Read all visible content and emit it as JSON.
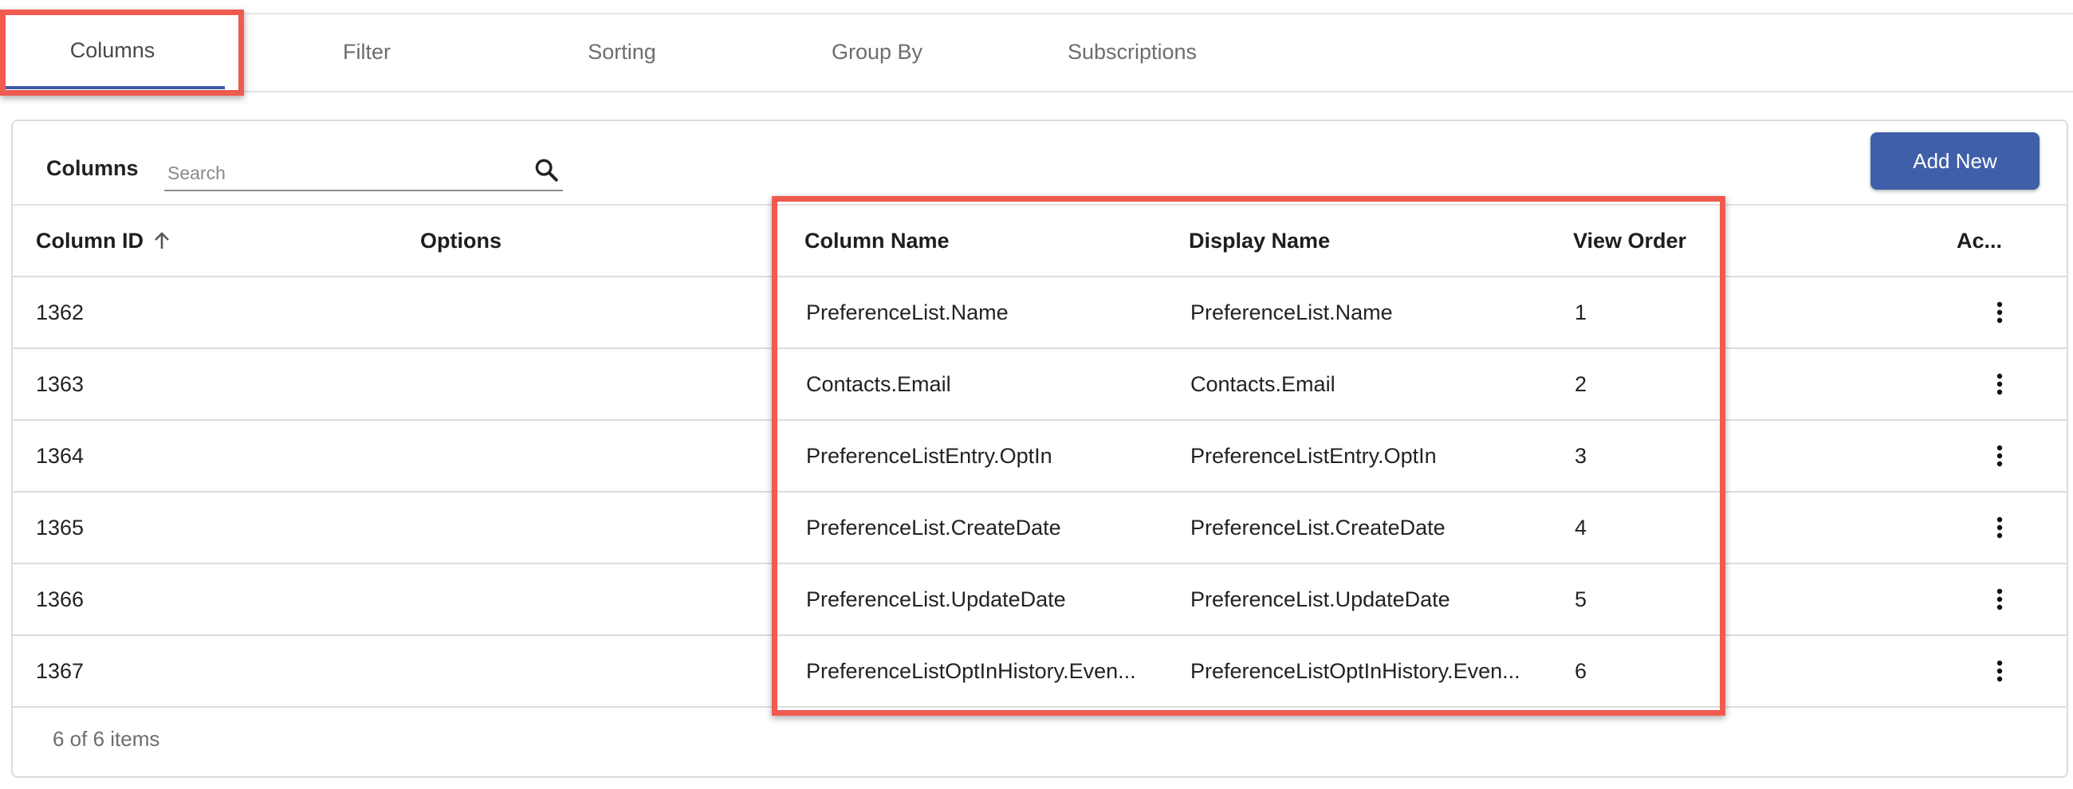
{
  "tabs": [
    {
      "label": "Columns",
      "active": true
    },
    {
      "label": "Filter",
      "active": false
    },
    {
      "label": "Sorting",
      "active": false
    },
    {
      "label": "Group By",
      "active": false
    },
    {
      "label": "Subscriptions",
      "active": false
    }
  ],
  "toolbar": {
    "title": "Columns",
    "search_placeholder": "Search",
    "search_value": "",
    "add_button_label": "Add New"
  },
  "table": {
    "headers": {
      "column_id": "Column ID",
      "options": "Options",
      "column_name": "Column Name",
      "display_name": "Display Name",
      "view_order": "View Order",
      "actions": "Ac..."
    },
    "sort": {
      "column": "Column ID",
      "direction": "ascending"
    },
    "rows": [
      {
        "id": "1362",
        "options": "",
        "column_name": "PreferenceList.Name",
        "display_name": "PreferenceList.Name",
        "view_order": "1"
      },
      {
        "id": "1363",
        "options": "",
        "column_name": "Contacts.Email",
        "display_name": "Contacts.Email",
        "view_order": "2"
      },
      {
        "id": "1364",
        "options": "",
        "column_name": "PreferenceListEntry.OptIn",
        "display_name": "PreferenceListEntry.OptIn",
        "view_order": "3"
      },
      {
        "id": "1365",
        "options": "",
        "column_name": "PreferenceList.CreateDate",
        "display_name": "PreferenceList.CreateDate",
        "view_order": "4"
      },
      {
        "id": "1366",
        "options": "",
        "column_name": "PreferenceList.UpdateDate",
        "display_name": "PreferenceList.UpdateDate",
        "view_order": "5"
      },
      {
        "id": "1367",
        "options": "",
        "column_name": "PreferenceListOptInHistory.Even...",
        "display_name": "PreferenceListOptInHistory.Even...",
        "view_order": "6"
      }
    ]
  },
  "footer": {
    "items_text": "6 of 6 items"
  },
  "icons": {
    "search": "search-icon",
    "sort": "arrow-up-icon",
    "row_menu": "more-vertical-icon"
  },
  "colors": {
    "accent": "#3f5fa8",
    "highlight": "#f05a4f",
    "tab_underline": "#3f5aa6"
  }
}
